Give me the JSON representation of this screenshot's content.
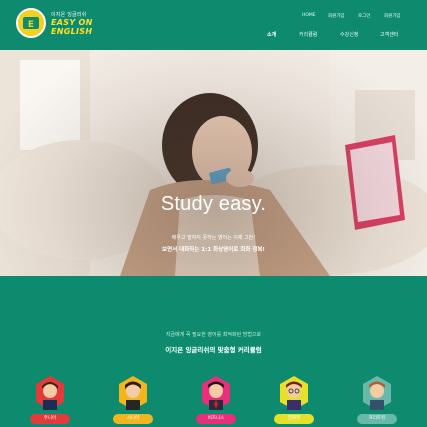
{
  "header": {
    "logo": {
      "small": "이지온 잉글리쉬",
      "big_line1": "EASY ON",
      "big_line2": "ENGLISH",
      "badge": "EE"
    },
    "util_nav": [
      "HOME",
      "회원가입",
      "로그인",
      "회원가입"
    ],
    "main_nav": [
      {
        "label": "소개",
        "active": true
      },
      {
        "label": "커리큘럼",
        "active": false
      },
      {
        "label": "수강신청",
        "active": false
      },
      {
        "label": "고객센터",
        "active": false
      }
    ]
  },
  "hero": {
    "title": "Study easy.",
    "line1": "배우고 말하지 못하는 영어는 이제 그만!",
    "line2": "보면서 대화하는 1:1 화상영어로 회화 정복!"
  },
  "curriculum": {
    "subtitle": "지금에게 꼭 필요한 영어를 최적화된 방법으로",
    "title": "이지온 잉글리쉬의 맞춤형 커리큘럼",
    "courses": [
      {
        "label": "주니어",
        "color": "#e33a3a",
        "icon": "junior-student-icon"
      },
      {
        "label": "시니어",
        "color": "#f2b51b",
        "icon": "senior-student-icon"
      },
      {
        "label": "비즈니스",
        "color": "#ea2f7a",
        "icon": "business-person-icon"
      },
      {
        "label": "전화영",
        "color": "#e6e02a",
        "icon": "phone-english-icon"
      },
      {
        "label": "프리토킹",
        "color": "#69b9a8",
        "icon": "free-talking-icon"
      }
    ]
  },
  "colors": {
    "brand_green": "#0e8a6e",
    "logo_yellow": "#ffe12a"
  }
}
